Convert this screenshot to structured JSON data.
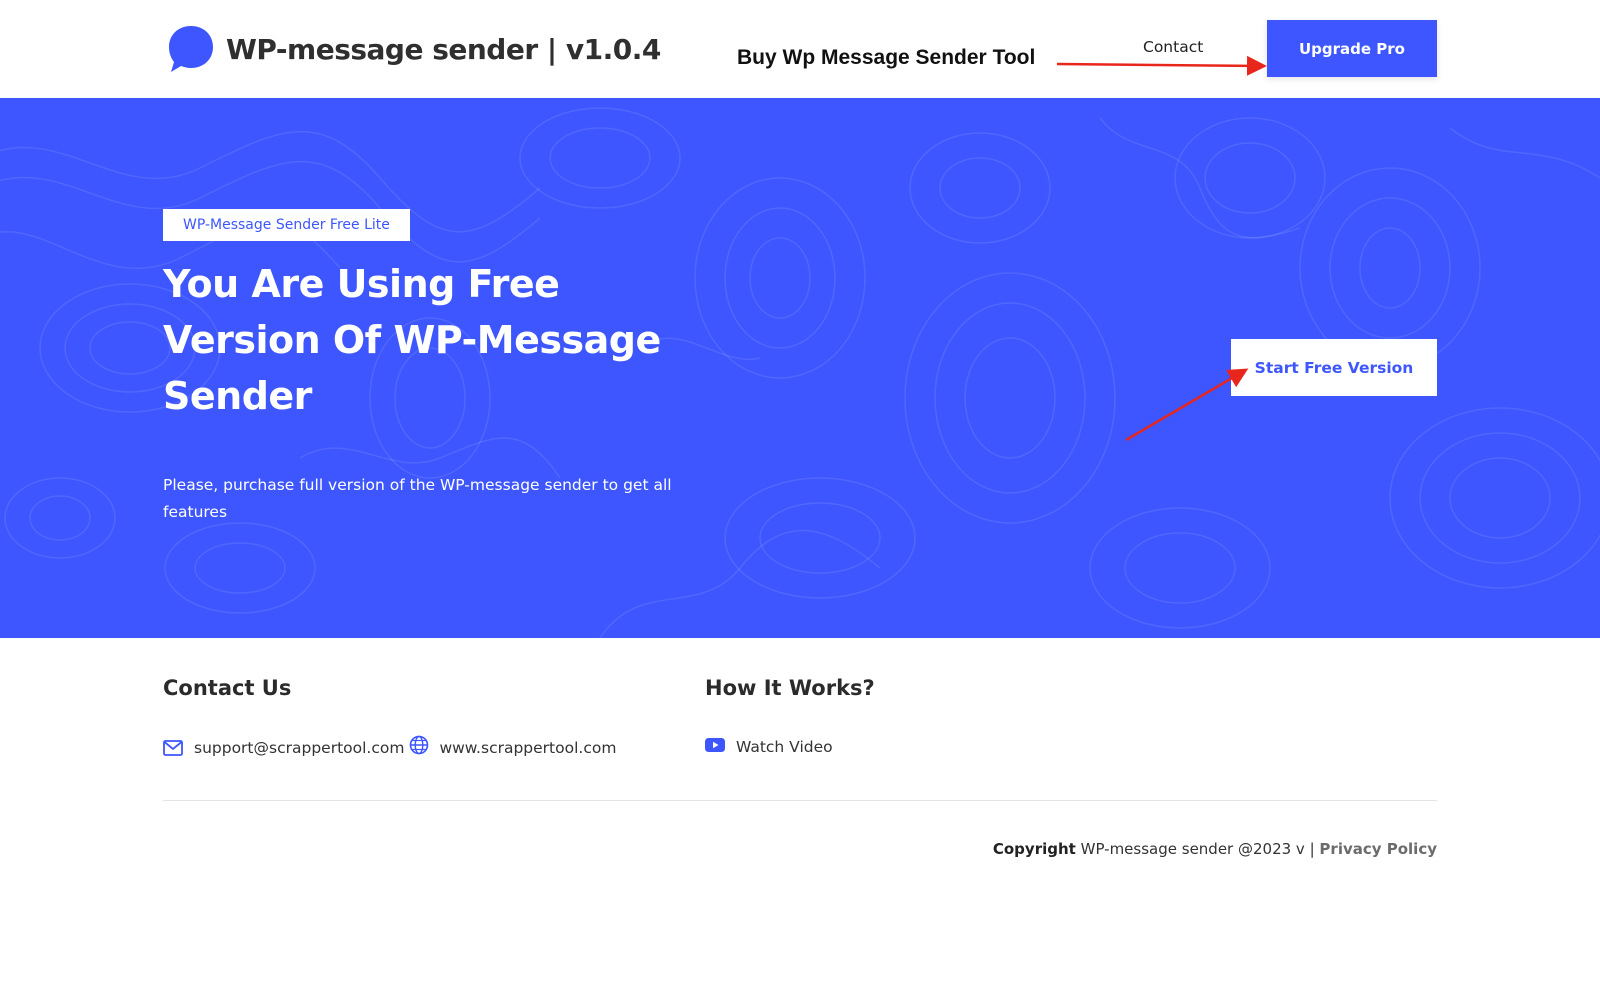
{
  "header": {
    "logo_text": "WP-message sender | v1.0.4",
    "annotation": "Buy Wp Message Sender Tool",
    "nav_contact": "Contact",
    "upgrade_button": "Upgrade Pro"
  },
  "hero": {
    "badge": "WP-Message Sender Free Lite",
    "title": "You Are Using Free Version Of WP-Message Sender",
    "description": "Please, purchase full version of the WP-message sender to get all features",
    "start_button": "Start Free Version"
  },
  "footer": {
    "contact_title": "Contact Us",
    "email": "support@scrappertool.com",
    "website": "www.scrappertool.com",
    "how_title": "How It Works?",
    "watch_video": "Watch Video",
    "copyright_label": "Copyright",
    "copyright_text": "WP-message sender @2023 v |",
    "privacy_policy": "Privacy Policy"
  },
  "colors": {
    "brand_blue": "#3d56ff",
    "annotation_red": "#e8261b",
    "white": "#ffffff"
  },
  "icons": {
    "logo": "chat-bubble-icon",
    "email": "mail-icon",
    "website": "globe-icon",
    "video": "youtube-icon"
  }
}
